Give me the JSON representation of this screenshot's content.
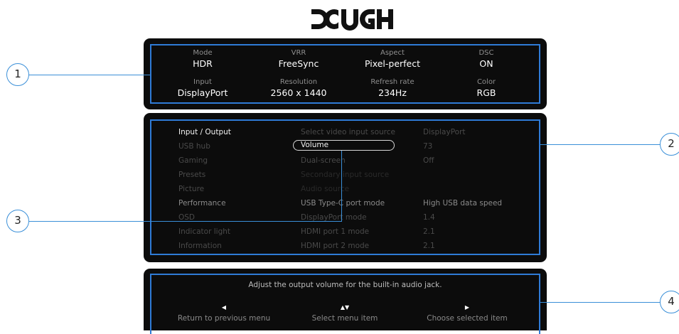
{
  "brand": {
    "logo_text": "DOUGH"
  },
  "status": {
    "cells": [
      {
        "label": "Mode",
        "value": "HDR"
      },
      {
        "label": "VRR",
        "value": "FreeSync"
      },
      {
        "label": "Aspect",
        "value": "Pixel-perfect"
      },
      {
        "label": "DSC",
        "value": "ON"
      },
      {
        "label": "Input",
        "value": "DisplayPort"
      },
      {
        "label": "Resolution",
        "value": "2560 x 1440"
      },
      {
        "label": "Refresh rate",
        "value": "234Hz"
      },
      {
        "label": "Color",
        "value": "RGB"
      }
    ]
  },
  "menu": {
    "categories": [
      "Input / Output",
      "USB hub",
      "Gaming",
      "Presets",
      "Picture",
      "Performance",
      "OSD",
      "Indicator light",
      "Information"
    ],
    "items": [
      {
        "label": "Select video input source",
        "value": "DisplayPort"
      },
      {
        "label": "Volume",
        "value": "73"
      },
      {
        "label": "Dual-screen",
        "value": "Off"
      },
      {
        "label": "Secondary input source",
        "value": ""
      },
      {
        "label": "Audio source",
        "value": ""
      },
      {
        "label": "USB Type-C port mode",
        "value": "High USB data speed"
      },
      {
        "label": "DisplayPort mode",
        "value": "1.4"
      },
      {
        "label": "HDMI port 1 mode",
        "value": "2.1"
      },
      {
        "label": "HDMI port 2 mode",
        "value": "2.1"
      }
    ]
  },
  "help": {
    "description": "Adjust the output volume for the built-in audio jack.",
    "actions": [
      {
        "arrow": "◀",
        "label": "Return to previous menu"
      },
      {
        "arrow": "▲▼",
        "label": "Select menu item"
      },
      {
        "arrow": "▶",
        "label": "Choose selected item"
      }
    ]
  },
  "callouts": [
    "1",
    "2",
    "3",
    "4"
  ],
  "colors": {
    "accent": "#2f7bd6",
    "panel": "#0c0c0c"
  }
}
